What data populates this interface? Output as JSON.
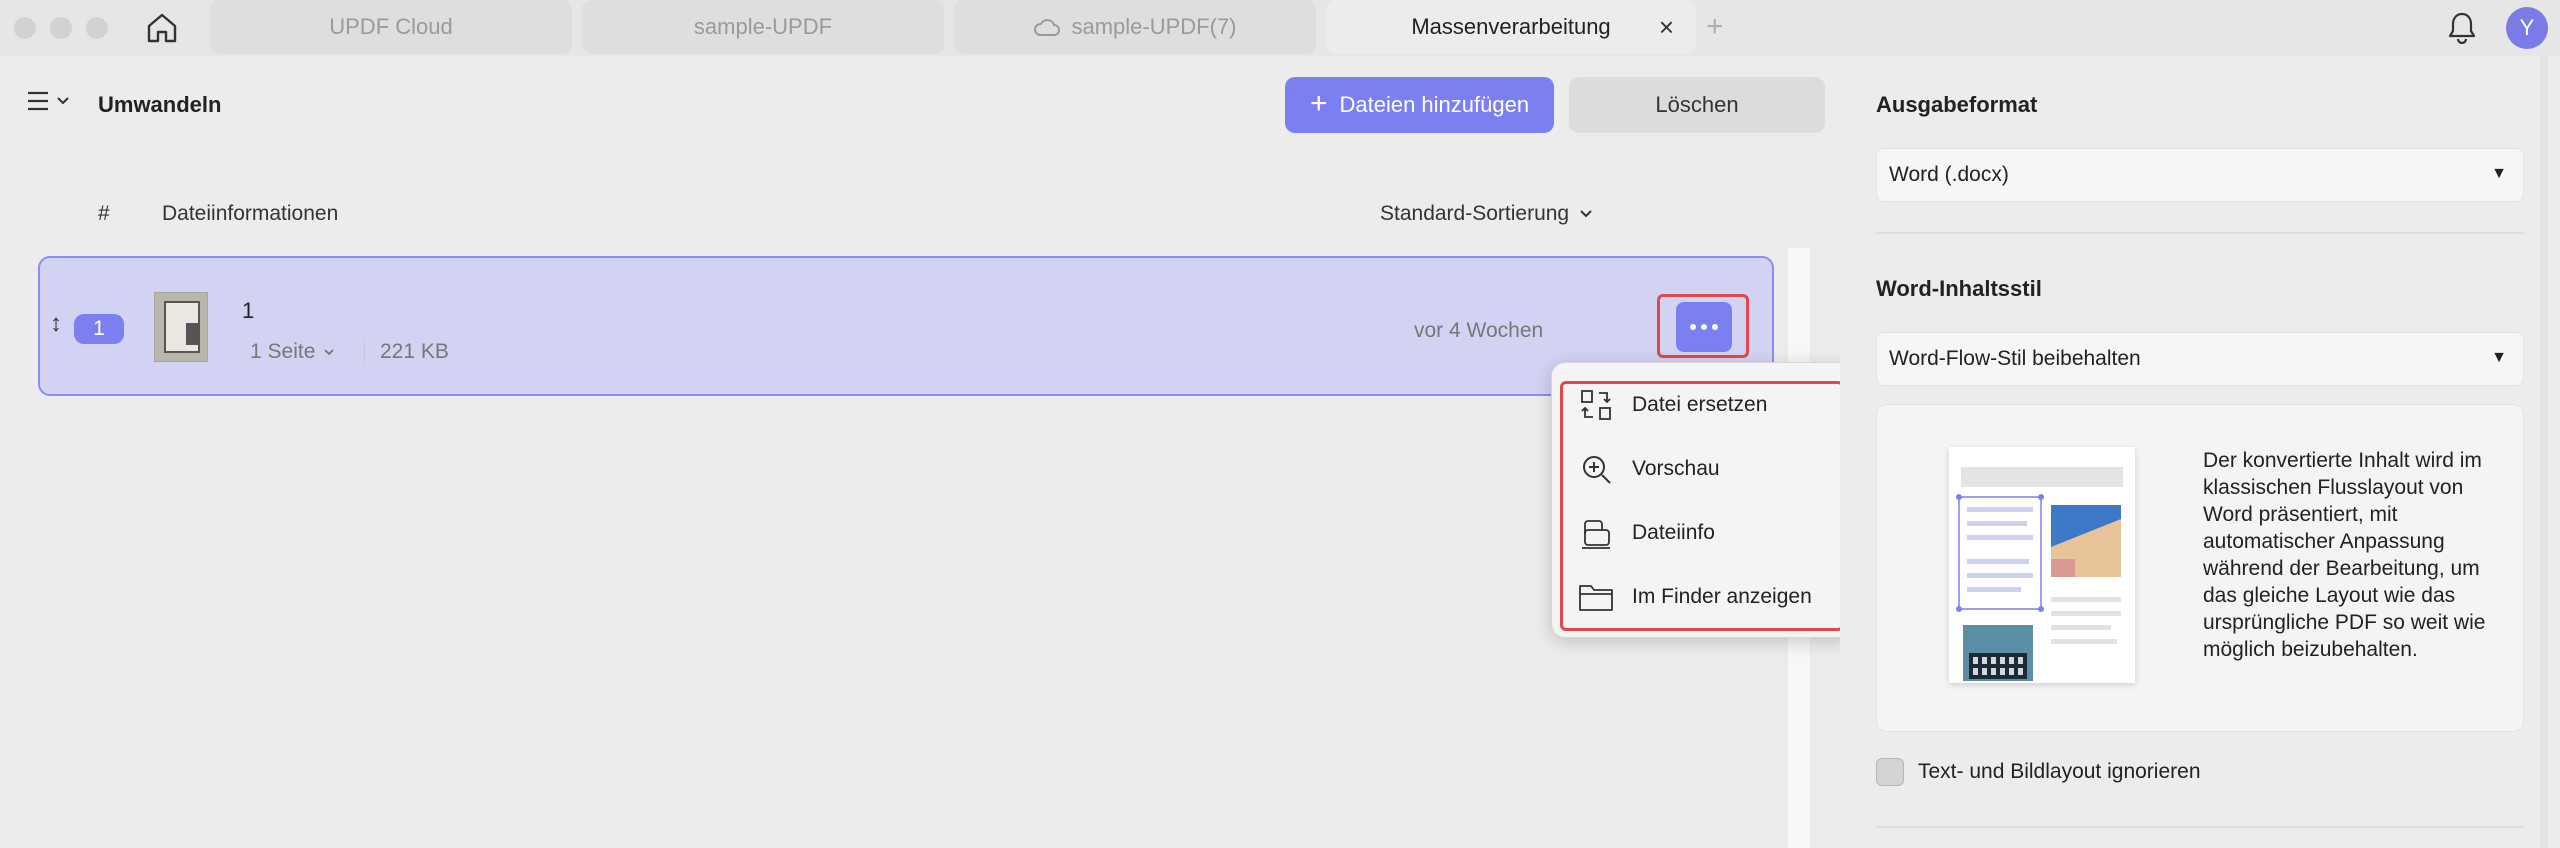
{
  "tabs": {
    "cloud": "UPDF Cloud",
    "sample": "sample-UPDF",
    "sample7": "sample-UPDF(7)",
    "batch": "Massenverarbeitung"
  },
  "user": {
    "avatar_letter": "Y"
  },
  "main": {
    "title": "Umwandeln",
    "add_files": "Dateien hinzufügen",
    "clear": "Löschen",
    "col_hash": "#",
    "col_info": "Dateiinformationen",
    "sort": "Standard-Sortierung"
  },
  "file": {
    "index": "1",
    "name": "1",
    "pages": "1 Seite",
    "size": "221 KB",
    "date": "vor 4 Wochen"
  },
  "context_menu": {
    "items": [
      {
        "label": "Datei ersetzen",
        "icon": "replace-icon"
      },
      {
        "label": "Vorschau",
        "icon": "zoom-in-icon"
      },
      {
        "label": "Dateiinfo",
        "icon": "file-info-icon"
      },
      {
        "label": "Im Finder anzeigen",
        "icon": "folder-icon"
      }
    ]
  },
  "settings": {
    "output_format_label": "Ausgabeformat",
    "output_format_value": "Word (.docx)",
    "content_style_label": "Word-Inhaltsstil",
    "content_style_value": "Word-Flow-Stil beibehalten",
    "description": "Der konvertierte Inhalt wird im klassischen Flusslayout von Word präsentiert, mit automatischer Anpassung während der Bearbeitung, um das gleiche Layout wie das ursprüngliche PDF so weit wie möglich beizubehalten.",
    "ignore_layout_label": "Text- und Bildlayout ignorieren",
    "ignore_layout_checked": false
  },
  "colors": {
    "accent": "#7b7ff0",
    "highlight": "#e0484b",
    "selected_row": "#d2d3f2"
  }
}
